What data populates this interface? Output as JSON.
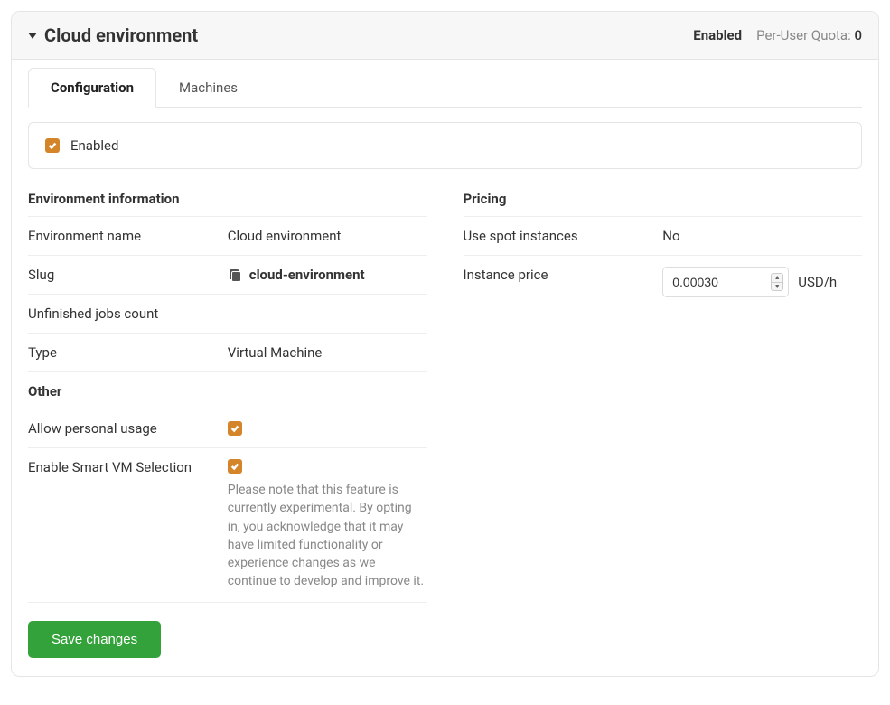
{
  "header": {
    "title": "Cloud environment",
    "status": "Enabled",
    "quota_label": "Per-User Quota:",
    "quota_value": "0"
  },
  "tabs": {
    "configuration": "Configuration",
    "machines": "Machines"
  },
  "enabled_box": {
    "label": "Enabled",
    "checked": true
  },
  "env_info": {
    "section_title": "Environment information",
    "name_label": "Environment name",
    "name_value": "Cloud environment",
    "slug_label": "Slug",
    "slug_value": "cloud-environment",
    "jobs_label": "Unfinished jobs count",
    "jobs_value": "",
    "type_label": "Type",
    "type_value": "Virtual Machine"
  },
  "other": {
    "section_title": "Other",
    "personal_label": "Allow personal usage",
    "personal_checked": true,
    "smart_label": "Enable Smart VM Selection",
    "smart_checked": true,
    "smart_help": "Please note that this feature is currently experimental. By opting in, you acknowledge that it may have limited functionality or experience changes as we continue to develop and improve it."
  },
  "pricing": {
    "section_title": "Pricing",
    "spot_label": "Use spot instances",
    "spot_value": "No",
    "price_label": "Instance price",
    "price_value": "0.00030",
    "price_unit": "USD/h"
  },
  "actions": {
    "save": "Save changes"
  }
}
